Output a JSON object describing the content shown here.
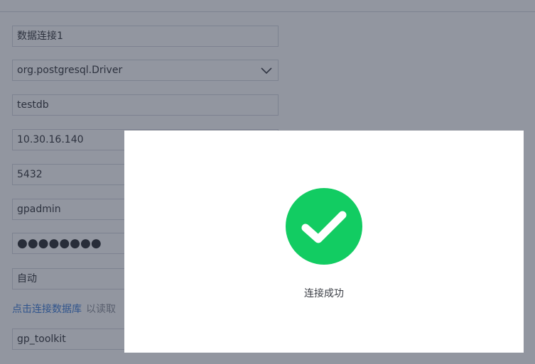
{
  "form": {
    "connection_name": "数据连接1",
    "driver": "org.postgresql.Driver",
    "database": "testdb",
    "host": "10.30.16.140",
    "port": "5432",
    "username": "gpadmin",
    "password_mask": "●●●●●●●●",
    "encoding": "自动",
    "connect_link": "点击连接数据库",
    "connect_hint": "以读取",
    "schema": "gp_toolkit"
  },
  "modal": {
    "message": "连接成功",
    "icon": "check-circle-icon",
    "icon_color": "#12cc62"
  },
  "colors": {
    "link": "#3b7bd6",
    "overlay": "rgba(38,46,66,0.5)",
    "success": "#12cc62"
  }
}
